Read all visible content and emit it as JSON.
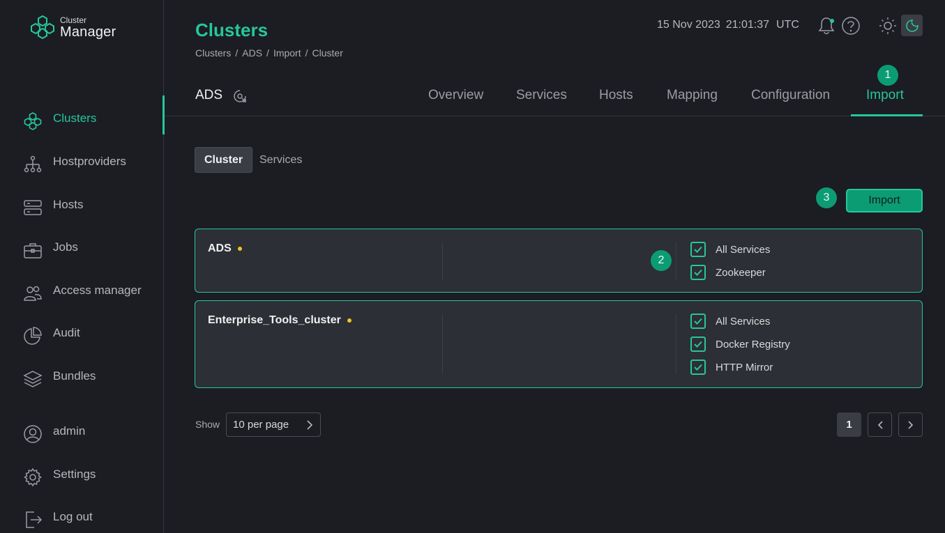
{
  "app": {
    "logo_small": "Cluster",
    "logo_big": "Manager",
    "accent_color": "#27c79a"
  },
  "sidebar": {
    "items": [
      {
        "label": "Clusters",
        "icon": "clusters-icon",
        "active": true
      },
      {
        "label": "Hostproviders",
        "icon": "hostproviders-icon"
      },
      {
        "label": "Hosts",
        "icon": "hosts-icon"
      },
      {
        "label": "Jobs",
        "icon": "jobs-icon"
      },
      {
        "label": "Access manager",
        "icon": "access-manager-icon"
      },
      {
        "label": "Audit",
        "icon": "audit-icon"
      },
      {
        "label": "Bundles",
        "icon": "bundles-icon"
      }
    ],
    "bottom_items": [
      {
        "label": "admin",
        "icon": "user-icon"
      },
      {
        "label": "Settings",
        "icon": "settings-icon"
      },
      {
        "label": "Log out",
        "icon": "logout-icon"
      }
    ]
  },
  "header": {
    "title": "Clusters",
    "breadcrumb": [
      "Clusters",
      "ADS",
      "Import",
      "Cluster"
    ],
    "breadcrumb_sep": "/",
    "date": "15 Nov 2023",
    "time": "21:01:37",
    "timezone": "UTC"
  },
  "entity": {
    "name": "ADS",
    "tabs": [
      "Overview",
      "Services",
      "Hosts",
      "Mapping",
      "Configuration",
      "Import"
    ],
    "active_tab": "Import"
  },
  "badges": {
    "tab": "1",
    "card": "2",
    "button": "3"
  },
  "subtabs": {
    "items": [
      "Cluster",
      "Services"
    ],
    "active": "Cluster"
  },
  "import_button": "Import",
  "cards": [
    {
      "name": "ADS",
      "status_color": "#f0c228",
      "services": [
        "All Services",
        "Zookeeper"
      ]
    },
    {
      "name": "Enterprise_Tools_cluster",
      "status_color": "#f0c228",
      "services": [
        "All Services",
        "Docker Registry",
        "HTTP Mirror"
      ]
    }
  ],
  "pagination": {
    "show_label": "Show",
    "per_page": "10 per page",
    "current_page": "1"
  }
}
